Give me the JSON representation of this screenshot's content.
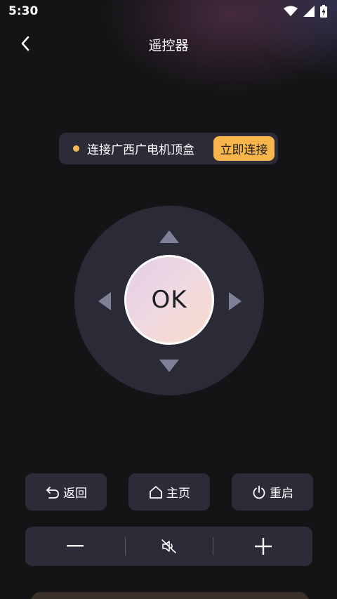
{
  "status_bar": {
    "time": "5:30",
    "icons": [
      "wifi-icon",
      "cellular-signal-icon",
      "battery-charging-icon"
    ]
  },
  "header": {
    "back_icon": "chevron-left-icon",
    "title": "遥控器"
  },
  "connection": {
    "status_text": "连接广西广电机顶盒",
    "status_color": "#f7b955",
    "button_label": "立即连接",
    "button_color": "#f8b54b"
  },
  "dpad": {
    "ok_label": "OK",
    "arrows": [
      "arrow-up-icon",
      "arrow-down-icon",
      "arrow-left-icon",
      "arrow-right-icon"
    ],
    "arrow_color": "#7f8198"
  },
  "function_buttons": [
    {
      "label": "返回",
      "icon": "back-arrow-icon"
    },
    {
      "label": "主页",
      "icon": "home-icon"
    },
    {
      "label": "重启",
      "icon": "power-icon"
    }
  ],
  "volume": {
    "icons": [
      "minus-icon",
      "mute-icon",
      "plus-icon"
    ]
  },
  "colors": {
    "background": "#141416",
    "panel": "#2b2c37",
    "dpad": "#2a2b36"
  }
}
